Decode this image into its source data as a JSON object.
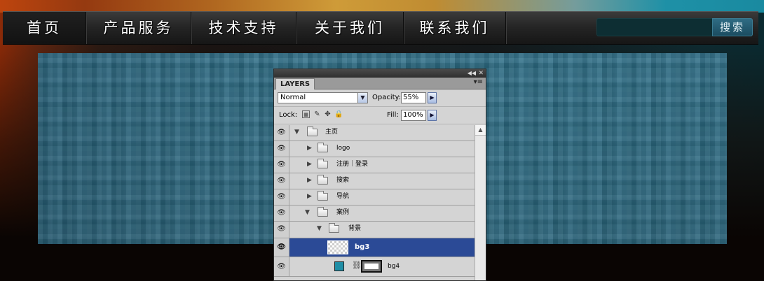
{
  "nav": {
    "items": [
      {
        "label": "首页"
      },
      {
        "label": "产品服务"
      },
      {
        "label": "技术支持"
      },
      {
        "label": "关于我们"
      },
      {
        "label": "联系我们"
      }
    ],
    "search_value": "",
    "search_button": "搜索"
  },
  "layers_panel": {
    "tab": "LAYERS",
    "blend_mode": "Normal",
    "opacity_label": "Opacity:",
    "opacity_value": "55%",
    "lock_label": "Lock:",
    "fill_label": "Fill:",
    "fill_value": "100%",
    "layers": [
      {
        "name": "主页",
        "type": "group",
        "expanded": true,
        "indent": 0
      },
      {
        "name": "logo",
        "type": "group",
        "expanded": false,
        "indent": 1
      },
      {
        "name": "注册｜登录",
        "type": "group",
        "expanded": false,
        "indent": 1
      },
      {
        "name": "搜索",
        "type": "group",
        "expanded": false,
        "indent": 1
      },
      {
        "name": "导航",
        "type": "group",
        "expanded": false,
        "indent": 1
      },
      {
        "name": "案例",
        "type": "group",
        "expanded": true,
        "indent": 1
      },
      {
        "name": "背景",
        "type": "group",
        "expanded": true,
        "indent": 2
      },
      {
        "name": "bg3",
        "type": "layer",
        "selected": true
      },
      {
        "name": "bg4",
        "type": "layer_with_mask",
        "swatch_color": "#1f8ea6"
      }
    ]
  },
  "colors": {
    "selection": "#2b4a96",
    "mosaic": "#2e6f88",
    "search_button": "#2f6c84"
  }
}
